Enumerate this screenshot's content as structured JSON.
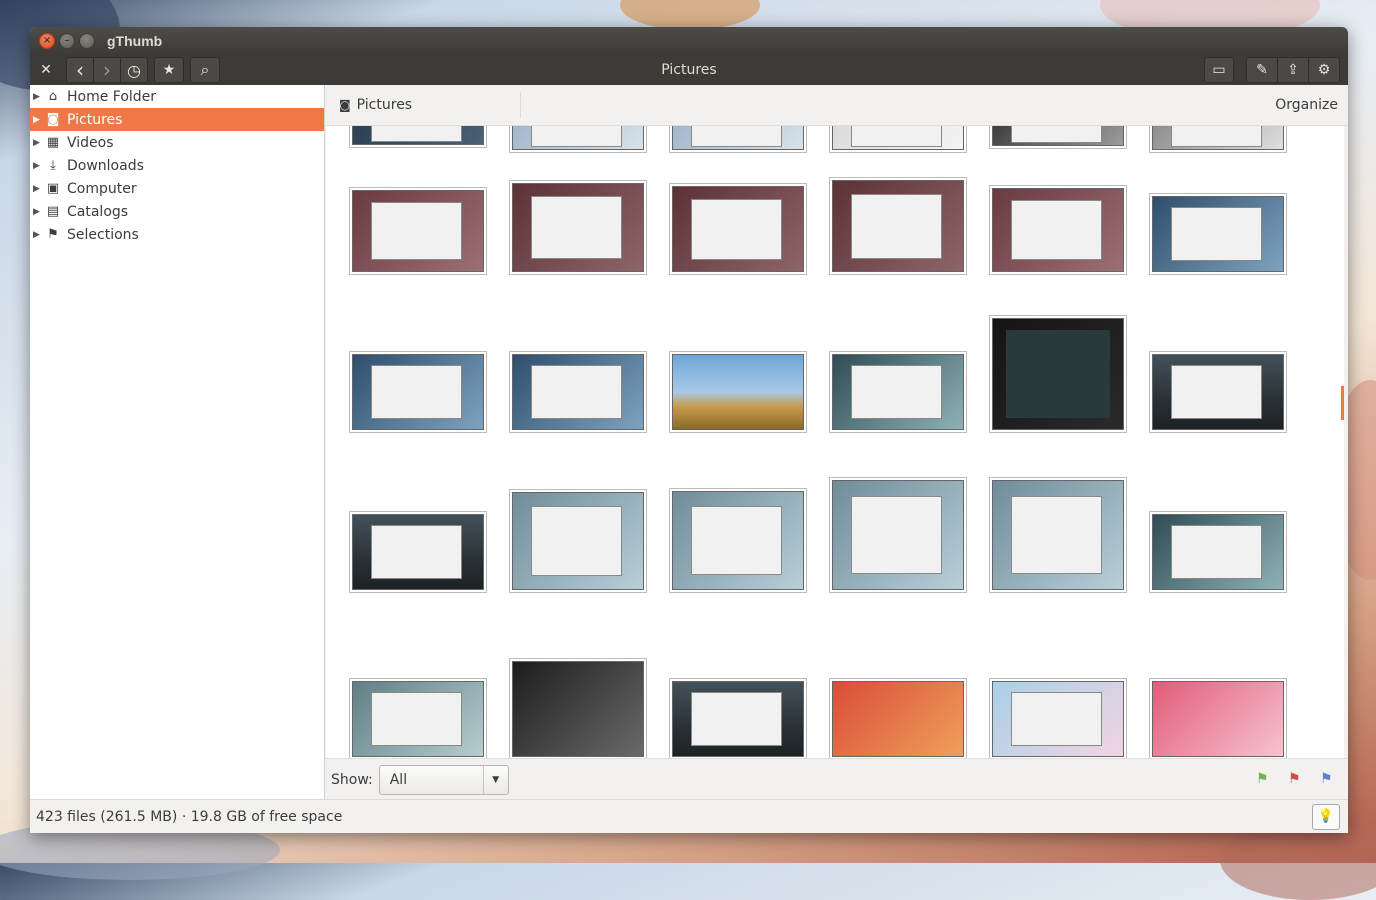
{
  "window": {
    "title": "gThumb"
  },
  "toolbar": {
    "close": "✕",
    "back": "‹",
    "forward": "›",
    "history": "◷",
    "bookmarks": "★",
    "search": "⌕",
    "title": "Pictures",
    "presentation": "▭",
    "tools": "✎",
    "share": "⇪",
    "preferences": "⚙"
  },
  "sidebar": {
    "items": [
      {
        "label": "Home Folder",
        "icon": "home-icon"
      },
      {
        "label": "Pictures",
        "icon": "camera-icon",
        "selected": true
      },
      {
        "label": "Videos",
        "icon": "film-icon"
      },
      {
        "label": "Downloads",
        "icon": "download-icon"
      },
      {
        "label": "Computer",
        "icon": "computer-icon"
      },
      {
        "label": "Catalogs",
        "icon": "catalog-icon"
      },
      {
        "label": "Selections",
        "icon": "flag-icon"
      }
    ]
  },
  "location": {
    "name": "Pictures",
    "organize": "Organize"
  },
  "filter": {
    "label": "Show:",
    "value": "All"
  },
  "flags": {
    "colors": [
      "#6fb55a",
      "#d24a4a",
      "#5a86c9"
    ]
  },
  "status": {
    "text": "423 files (261.5 MB)  ·  19.8 GB of free space"
  },
  "thumbnails": [
    {
      "row": 0,
      "col": 0,
      "theme": "dark-leaves"
    },
    {
      "row": 0,
      "col": 1,
      "theme": "dialog-blue"
    },
    {
      "row": 0,
      "col": 2,
      "theme": "dialog-blue"
    },
    {
      "row": 0,
      "col": 3,
      "theme": "list-green"
    },
    {
      "row": 0,
      "col": 4,
      "theme": "panel-dark"
    },
    {
      "row": 0,
      "col": 5,
      "theme": "gray"
    },
    {
      "row": 1,
      "col": 0,
      "theme": "mauve-green"
    },
    {
      "row": 1,
      "col": 1,
      "theme": "mauve"
    },
    {
      "row": 1,
      "col": 2,
      "theme": "mauve"
    },
    {
      "row": 1,
      "col": 3,
      "theme": "mauve"
    },
    {
      "row": 1,
      "col": 4,
      "theme": "mauve-green"
    },
    {
      "row": 1,
      "col": 5,
      "theme": "frost"
    },
    {
      "row": 2,
      "col": 0,
      "theme": "frost"
    },
    {
      "row": 2,
      "col": 1,
      "theme": "frost"
    },
    {
      "row": 2,
      "col": 2,
      "theme": "tree"
    },
    {
      "row": 2,
      "col": 3,
      "theme": "teal"
    },
    {
      "row": 2,
      "col": 4,
      "theme": "menu-dark"
    },
    {
      "row": 2,
      "col": 5,
      "theme": "night"
    },
    {
      "row": 3,
      "col": 0,
      "theme": "night"
    },
    {
      "row": 3,
      "col": 1,
      "theme": "mixer"
    },
    {
      "row": 3,
      "col": 2,
      "theme": "mixer"
    },
    {
      "row": 3,
      "col": 3,
      "theme": "mixer"
    },
    {
      "row": 3,
      "col": 4,
      "theme": "mixer"
    },
    {
      "row": 3,
      "col": 5,
      "theme": "teal"
    },
    {
      "row": 4,
      "col": 0,
      "theme": "poweroff"
    },
    {
      "row": 4,
      "col": 1,
      "theme": "forest"
    },
    {
      "row": 4,
      "col": 2,
      "theme": "night"
    },
    {
      "row": 4,
      "col": 3,
      "theme": "flower"
    },
    {
      "row": 4,
      "col": 4,
      "theme": "dialog-pink"
    },
    {
      "row": 4,
      "col": 5,
      "theme": "pink"
    }
  ]
}
